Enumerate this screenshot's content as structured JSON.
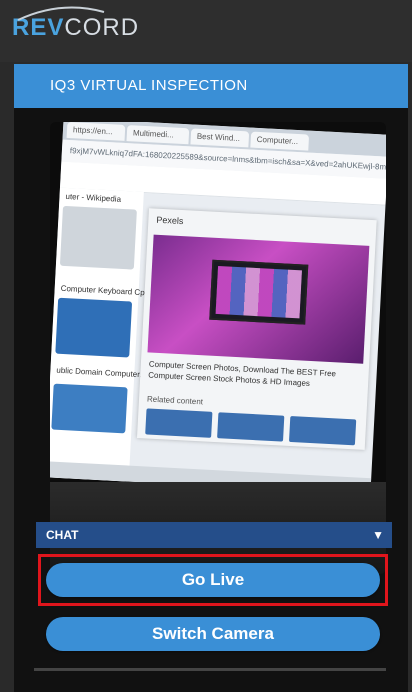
{
  "brand": {
    "rev": "REV",
    "cord": "CORD"
  },
  "panel": {
    "title": "IQ3 VIRTUAL INSPECTION"
  },
  "video": {
    "tabs": [
      "https://en...",
      "Multimedi...",
      "Best Wind...",
      "Computer..."
    ],
    "url": "f9xjM7vWLkniq7dFA:168020225589&source=lnms&tbm=isch&sa=X&ved=2ahUKEwjl-8m3...",
    "left_heading": "uter - Wikipedia",
    "left_label_1": "Computer Keyboard Cpu - F...",
    "left_label_2": "ublic Domain Computer...",
    "card_source": "Pexels",
    "card_caption": "Computer Screen Photos, Download The BEST Free Computer Screen Stock Photos & HD Images",
    "card_related": "Related content"
  },
  "chat": {
    "label": "CHAT",
    "caret": "▼"
  },
  "buttons": {
    "go_live": "Go Live",
    "switch_camera": "Switch Camera"
  },
  "colors": {
    "accent": "#3a8fd6",
    "chat_bar": "#254e8a",
    "highlight": "#e0151c"
  }
}
